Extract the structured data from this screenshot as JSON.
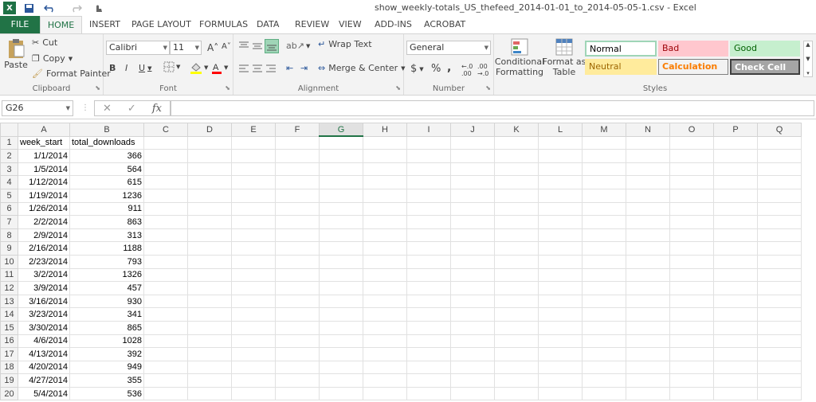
{
  "window": {
    "title": "show_weekly-totals_US_thefeed_2014-01-01_to_2014-05-05-1.csv - Excel"
  },
  "tabs": [
    "FILE",
    "HOME",
    "INSERT",
    "PAGE LAYOUT",
    "FORMULAS",
    "DATA",
    "REVIEW",
    "VIEW",
    "ADD-INS",
    "ACROBAT"
  ],
  "ribbon": {
    "clipboard": {
      "paste": "Paste",
      "cut": "Cut",
      "copy": "Copy",
      "format_painter": "Format Painter",
      "label": "Clipboard"
    },
    "font": {
      "name": "Calibri",
      "size": "11",
      "bold": "B",
      "italic": "I",
      "underline": "U",
      "label": "Font"
    },
    "alignment": {
      "wrap_text": "Wrap Text",
      "merge_center": "Merge & Center",
      "label": "Alignment"
    },
    "number": {
      "format": "General",
      "currency": "$",
      "percent": "%",
      "comma": ",",
      "label": "Number"
    },
    "styles": {
      "conditional_1": "Conditional",
      "conditional_2": "Formatting",
      "format_table_1": "Format as",
      "format_table_2": "Table",
      "normal": "Normal",
      "bad": "Bad",
      "good": "Good",
      "neutral": "Neutral",
      "calculation": "Calculation",
      "check_cell": "Check Cell",
      "label": "Styles"
    }
  },
  "formula_bar": {
    "name_box": "G26",
    "fx": "fx",
    "value": ""
  },
  "sheet": {
    "columns": [
      "A",
      "B",
      "C",
      "D",
      "E",
      "F",
      "G",
      "H",
      "I",
      "J",
      "K",
      "L",
      "M",
      "N",
      "O",
      "P",
      "Q"
    ],
    "selected_column": "G",
    "headers": [
      "week_start",
      "total_downloads"
    ],
    "rows": [
      [
        "1/1/2014",
        "366"
      ],
      [
        "1/5/2014",
        "564"
      ],
      [
        "1/12/2014",
        "615"
      ],
      [
        "1/19/2014",
        "1236"
      ],
      [
        "1/26/2014",
        "911"
      ],
      [
        "2/2/2014",
        "863"
      ],
      [
        "2/9/2014",
        "313"
      ],
      [
        "2/16/2014",
        "1188"
      ],
      [
        "2/23/2014",
        "793"
      ],
      [
        "3/2/2014",
        "1326"
      ],
      [
        "3/9/2014",
        "457"
      ],
      [
        "3/16/2014",
        "930"
      ],
      [
        "3/23/2014",
        "341"
      ],
      [
        "3/30/2014",
        "865"
      ],
      [
        "4/6/2014",
        "1028"
      ],
      [
        "4/13/2014",
        "392"
      ],
      [
        "4/20/2014",
        "949"
      ],
      [
        "4/27/2014",
        "355"
      ],
      [
        "5/4/2014",
        "536"
      ]
    ]
  }
}
